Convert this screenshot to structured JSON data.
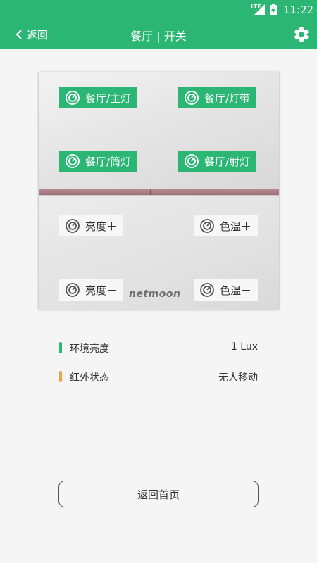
{
  "status_bar": {
    "network": "LTE",
    "time": "11:22"
  },
  "header": {
    "back_label": "返回",
    "title": "餐厅 | 开关"
  },
  "panel": {
    "switches": [
      "餐厅/主灯",
      "餐厅/灯带",
      "餐厅/筒灯",
      "餐厅/射灯"
    ],
    "controls": [
      "亮度＋",
      "色温＋",
      "亮度－",
      "色温－"
    ],
    "brand": "netmoon"
  },
  "sensors": [
    {
      "label": "环境亮度",
      "value": "1 Lux",
      "color": "#2bb673"
    },
    {
      "label": "红外状态",
      "value": "无人移动",
      "color": "#f0a04b"
    }
  ],
  "home_button": "返回首页",
  "colors": {
    "accent": "#2bb673",
    "ir_indicator": "#f0a04b"
  }
}
